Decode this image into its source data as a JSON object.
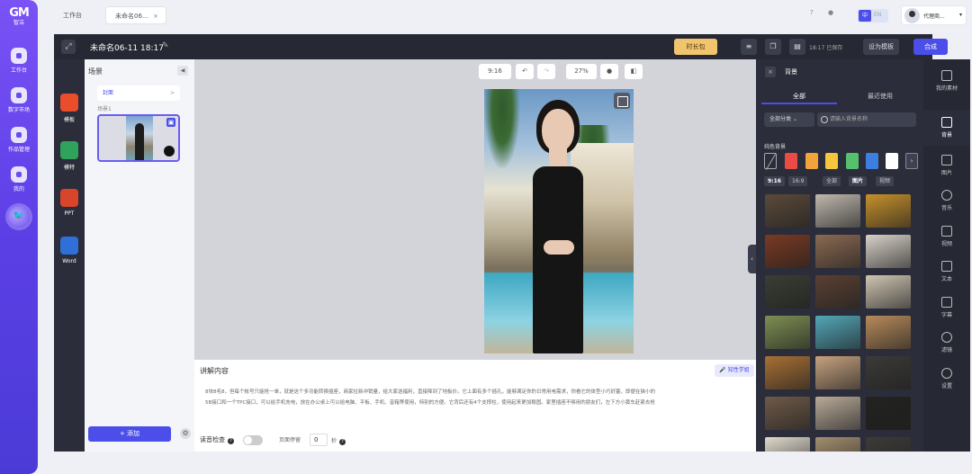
{
  "sidebar": {
    "logo": "GM",
    "logo_sub": "智洁",
    "items": [
      {
        "label": "工作台",
        "icon": "home-icon"
      },
      {
        "label": "数字市场",
        "icon": "market-icon"
      },
      {
        "label": "作品管理",
        "icon": "works-icon"
      },
      {
        "label": "我的",
        "icon": "user-icon"
      }
    ],
    "assistant_icon": "bird-assistant-icon"
  },
  "topbar": {
    "tabs": [
      {
        "label": "工作台"
      },
      {
        "label": "未命名06..."
      }
    ],
    "tab_close": "×",
    "help_icon": "?",
    "bell_icon": "●",
    "lang_zh": "中",
    "lang_en": "EN",
    "user_name": "代理商...",
    "user_dropdown": "▾"
  },
  "header": {
    "title": "未命名06-11 18:17",
    "edit_icon": "✎",
    "long_video": "时长包",
    "saved": "18:17 已保存",
    "template_button": "设为模板",
    "synth_button": "合成"
  },
  "tools": [
    {
      "label": "模板",
      "color": "#e94d2a"
    },
    {
      "label": "模特",
      "color": "#2fa35b"
    },
    {
      "label": "PPT",
      "color": "#d9452b"
    },
    {
      "label": "Word",
      "color": "#2f6fd9"
    }
  ],
  "scenes": {
    "header": "场景",
    "collapse_icon": "◀",
    "cover": "封面",
    "cover_chevron": ">",
    "scene1": "场景1",
    "delete_icon": "▣",
    "add_button": "+ 添加",
    "settings_icon": "⚙"
  },
  "canvas_tools": {
    "ratio": "9:16",
    "undo": "↶",
    "redo": "↷",
    "zoom": "27%",
    "bg_icon": "●",
    "flip_icon": "◧"
  },
  "script": {
    "header": "讲解内容",
    "smart_button": "知性学姐",
    "text_line1": "8块8毛8，但每个帐号只能抢一单，就是这个多功能转换插座，商家拉新冲销量，给大家送福利，直接降到了地板价。它上面有多个插孔，能够满足你的日常用电需求，你看它的体型小巧好塞，即便在狭小的",
    "text_line2": "5B接口和一个TPC接口，可以给手机充电，放在办公桌上可以给电脑、平板、手机、音箱等使用，特别的方便。它背后还有4个支撑柱，使用起来更加稳固。家里插座不够用的朋友们，左下方小黄车赶紧去抢",
    "read_check": "读音检查",
    "read_check_help": "?",
    "pause_label": "页面停留",
    "pause_value": "0",
    "pause_unit": "秒",
    "pause_help": "?"
  },
  "panel": {
    "close": "×",
    "title": "背景",
    "tab_all": "全部",
    "tab_recent": "最近使用",
    "category": "全部分类",
    "category_chevron": "⌄",
    "search_placeholder": "请输入背景名称",
    "pure_color_label": "纯色背景",
    "colors": [
      "#e94b45",
      "#f2a33a",
      "#f5c73b",
      "#55c06e",
      "#3d7fe0",
      "#ffffff"
    ],
    "more_colors": "›",
    "filters": [
      "9:16",
      "16:9",
      "全部",
      "图片",
      "视频"
    ],
    "thumbnail_colors": [
      [
        "#5b4a3a",
        "#bfb8ad",
        "#c7912b"
      ],
      [
        "#7a3a22",
        "#8b6a52",
        "#d8d2c8"
      ],
      [
        "#3a3e33",
        "#5a4033",
        "#cfc5b2"
      ],
      [
        "#7e8f52",
        "#53a7b8",
        "#b88b5b"
      ],
      [
        "#a87035",
        "#c6a27e",
        "#3b3a37"
      ],
      [
        "#6f5a48",
        "#b9aa98",
        "#222320"
      ],
      [
        "#e0d9cc",
        "#a38e70",
        "#3d3b38"
      ]
    ]
  },
  "rail": [
    {
      "label": "我的素材"
    },
    {
      "label": "背景"
    },
    {
      "label": "图片"
    },
    {
      "label": "音乐"
    },
    {
      "label": "视频"
    },
    {
      "label": "文本"
    },
    {
      "label": "字幕"
    },
    {
      "label": "滤镜"
    },
    {
      "label": "设置"
    }
  ],
  "colors": {
    "accent": "#4b4ee8",
    "sidebar_top": "#7a52f5",
    "dark_panel": "#2b2d3a",
    "long_btn": "#f1c56e"
  }
}
